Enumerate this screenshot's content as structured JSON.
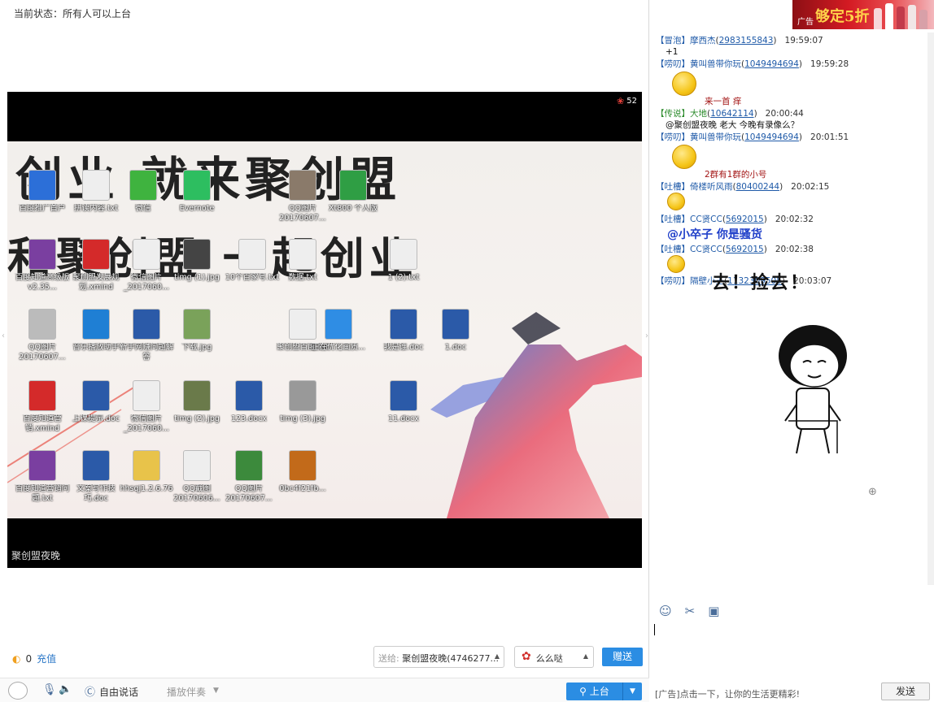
{
  "status": {
    "label": "当前状态：所有人可以上台"
  },
  "video": {
    "viewer_count": "52",
    "caption": "聚创盟夜晚",
    "wallpaper_text": [
      "创业  就来聚创盟",
      "和聚创盟  一起创业"
    ],
    "desktop_icons": [
      {
        "label": "百度推广首户",
        "color": "#2c6fd8"
      },
      {
        "label": "拼读内容.txt",
        "color": "#eeeeee"
      },
      {
        "label": "微信",
        "color": "#3fb33f"
      },
      {
        "label": "Evernote",
        "color": "#2dbe60"
      },
      {
        "label": "QQ图片20170607...",
        "color": "#8a7a6a"
      },
      {
        "label": "Xt800 个人版",
        "color": "#2f9e44"
      },
      {
        "label": "百度知道高级版v2.35...",
        "color": "#7a3fa0"
      },
      {
        "label": "聚创盟发展规划.xmind",
        "color": "#d42a2a"
      },
      {
        "label": "微信图片_2017060...",
        "color": "#eeeeee"
      },
      {
        "label": "timg (1).jpg",
        "color": "#444444"
      },
      {
        "label": "10个百家号.txt",
        "color": "#eeeeee"
      },
      {
        "label": "数据.txt",
        "color": "#eeeeee"
      },
      {
        "label": "1 (2).txt",
        "color": "#eeeeee"
      },
      {
        "label": "QQ图片20170607...",
        "color": "#bbbbbb"
      },
      {
        "label": "音乐播放助手",
        "color": "#1f7fd4"
      },
      {
        "label": "新手网赚问题解答",
        "color": "#2b5aa8"
      },
      {
        "label": "下载.jpg",
        "color": "#7aa25a"
      },
      {
        "label": "聚创盟百度.txt",
        "color": "#eeeeee"
      },
      {
        "label": "正在优化画质...",
        "color": "#2f8de4"
      },
      {
        "label": "我是谁.doc",
        "color": "#2b5aa8"
      },
      {
        "label": "1.doc",
        "color": "#2b5aa8"
      },
      {
        "label": "百度知道营销.xmind",
        "color": "#d42a2a"
      },
      {
        "label": "上课提示.doc",
        "color": "#2b5aa8"
      },
      {
        "label": "微信图片_2017060...",
        "color": "#eeeeee"
      },
      {
        "label": "timg (2).jpg",
        "color": "#6a7a4a"
      },
      {
        "label": "123.docx",
        "color": "#2b5aa8"
      },
      {
        "label": "timg (3).jpg",
        "color": "#999999"
      },
      {
        "label": "11.docx",
        "color": "#2b5aa8"
      },
      {
        "label": "百度知道营销问题.txt",
        "color": "#7a3fa0"
      },
      {
        "label": "文案写作技巧.doc",
        "color": "#2b5aa8"
      },
      {
        "label": "hhsqj1.2.6.76",
        "color": "#e8c34a"
      },
      {
        "label": "QQ截图20170606...",
        "color": "#eeeeee"
      },
      {
        "label": "QQ图片20170607...",
        "color": "#3c8a3c"
      },
      {
        "label": "0bc4f21fb...",
        "color": "#c26a1a"
      }
    ]
  },
  "gift_bar": {
    "coin_count": "0",
    "recharge_label": "充值",
    "send_to_label": "送给:",
    "send_to_value": "聚创盟夜晚(4746277...",
    "gift_name": "么么哒",
    "gift_button": "赠送"
  },
  "controls": {
    "free_speech": "自由说话",
    "accompany": "播放伴奏",
    "up_stage": "上台"
  },
  "ad": {
    "tag": "广告",
    "headline": "够定5折"
  },
  "chat": [
    {
      "role": "【冒泡】",
      "nick": "摩西杰",
      "uid": "2983155843",
      "time": "19:59:07",
      "body": "+1"
    },
    {
      "role": "【唠叨】",
      "nick": "黄叫兽带你玩",
      "uid": "1049494694",
      "time": "19:59:28",
      "body": "来一首   痒"
    },
    {
      "role": "【传说】",
      "nick": "大地",
      "uid": "10642114",
      "time": "20:00:44",
      "body": "@聚创盟夜晚 老大 今晚有录像么？"
    },
    {
      "role": "【唠叨】",
      "nick": "黄叫兽带你玩",
      "uid": "1049494694",
      "time": "20:01:51",
      "body": "2群有1群的小号"
    },
    {
      "role": "【吐槽】",
      "nick": "倚楼听风雨",
      "uid": "80400244",
      "time": "20:02:15",
      "body": ""
    },
    {
      "role": "【吐槽】",
      "nick": "CC贤CC",
      "uid": "5692015",
      "time": "20:02:32",
      "body": "@小卒子  你是骚货"
    },
    {
      "role": "【吐槽】",
      "nick": "CC贤CC",
      "uid": "5692015",
      "time": "20:02:38",
      "body": ""
    },
    {
      "role": "【唠叨】",
      "nick": "隔壁小王",
      "uid": "1132309505",
      "time": "20:03:07",
      "body": ""
    }
  ],
  "sticker_text": "去！捡去！",
  "bottom": {
    "ad_text": "[广告]点击一下，让你的生活更精彩!",
    "send_button": "发送"
  }
}
